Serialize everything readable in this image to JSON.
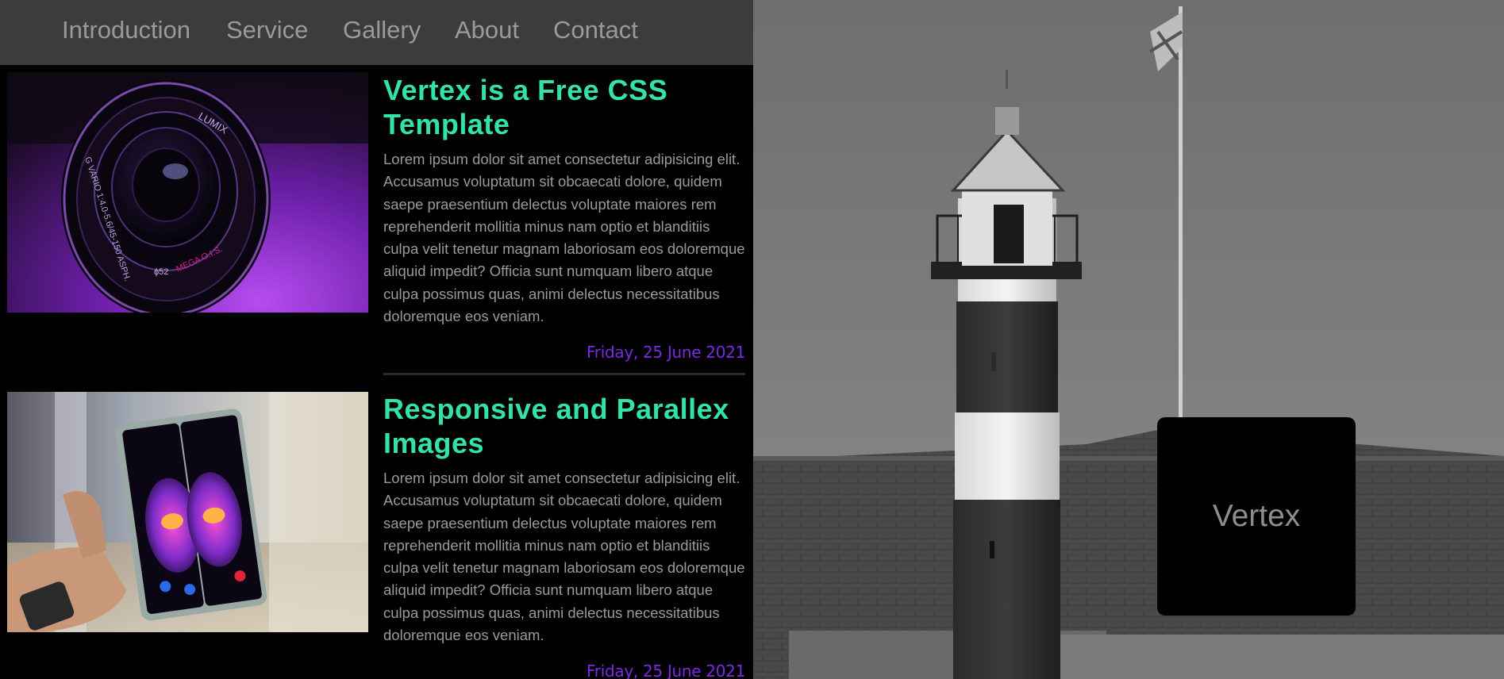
{
  "nav": {
    "items": [
      {
        "label": "Introduction"
      },
      {
        "label": "Service"
      },
      {
        "label": "Gallery"
      },
      {
        "label": "About"
      },
      {
        "label": "Contact"
      }
    ]
  },
  "articles": [
    {
      "title": "Vertex is a Free CSS Template",
      "body": "Lorem ipsum dolor sit amet consectetur adipisicing elit. Accusamus voluptatum sit obcaecati dolore, quidem saepe praesentium delectus voluptate maiores rem reprehenderit mollitia minus nam optio et blanditiis culpa velit tenetur magnam laboriosam eos doloremque aliquid impedit? Officia sunt numquam libero atque culpa possimus quas, animi delectus necessitatibus doloremque eos veniam.",
      "date": "Friday, 25 June 2021",
      "lens_text": {
        "brand": "LUMIX",
        "spec": "G VARIO 1:4.0-5.6/45-150 ASPH.",
        "filter": "ϕ52",
        "mega": "MEGA O.I.S."
      }
    },
    {
      "title": "Responsive and Parallex Images",
      "body": "Lorem ipsum dolor sit amet consectetur adipisicing elit. Accusamus voluptatum sit obcaecati dolore, quidem saepe praesentium delectus voluptate maiores rem reprehenderit mollitia minus nam optio et blanditiis culpa velit tenetur magnam laboriosam eos doloremque aliquid impedit? Officia sunt numquam libero atque culpa possimus quas, animi delectus necessitatibus doloremque eos veniam.",
      "date": "Friday, 25 June 2021"
    }
  ],
  "brand": {
    "name": "Vertex"
  },
  "colors": {
    "title": "#33e3a6",
    "date": "#7a2ae0",
    "nav_bg": "#3c3c3c",
    "text": "#9a9a9a"
  }
}
